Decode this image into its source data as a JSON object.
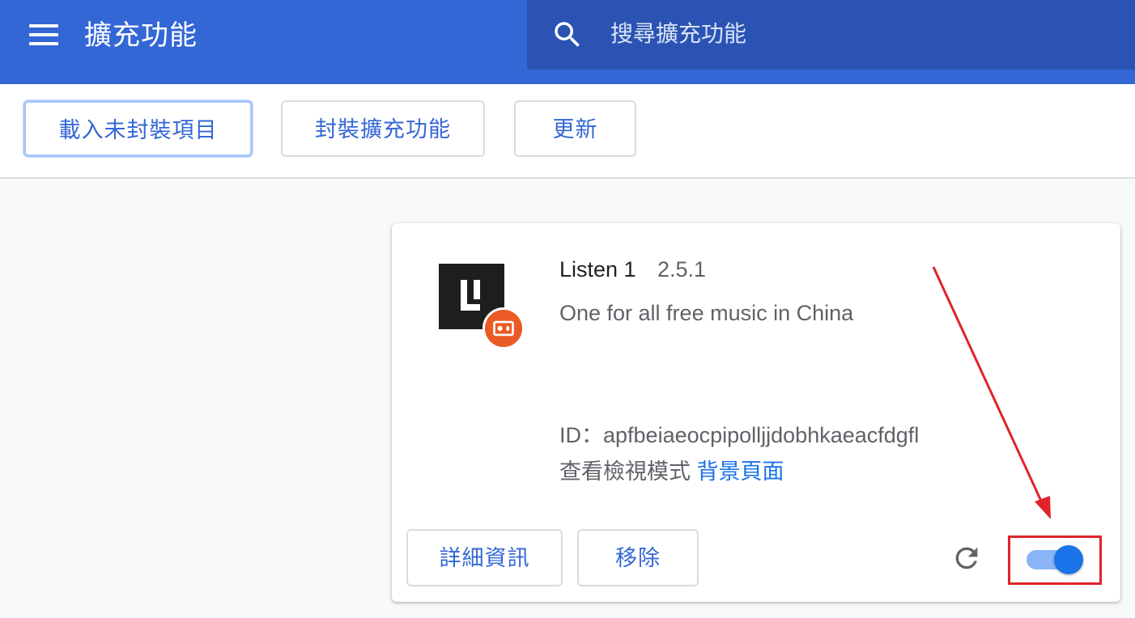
{
  "header": {
    "title": "擴充功能",
    "search_placeholder": "搜尋擴充功能"
  },
  "toolbar": {
    "load_unpacked_label": "載入未封裝項目",
    "pack_label": "封裝擴充功能",
    "update_label": "更新"
  },
  "extension": {
    "name": "Listen 1",
    "version": "2.5.1",
    "description": "One for all free music in China",
    "id_line": "ID：apfbeiaeocpipolljjdobhkaeacfdgfl",
    "views_label": "查看檢視模式",
    "background_page_link": "背景頁面",
    "details_label": "詳細資訊",
    "remove_label": "移除",
    "enabled": true
  },
  "icons": {
    "menu": "menu-icon",
    "search": "search-icon",
    "reload": "reload-icon",
    "extension": "listen1-logo-icon",
    "badge": "unpacked-badge-icon"
  },
  "colors": {
    "header": "#3367d6",
    "search_bg": "#2a53b3",
    "accent": "#1a73e8",
    "toggle_track": "#8ab4f8",
    "annotation": "#e0232b",
    "badge": "#ea5b25"
  }
}
